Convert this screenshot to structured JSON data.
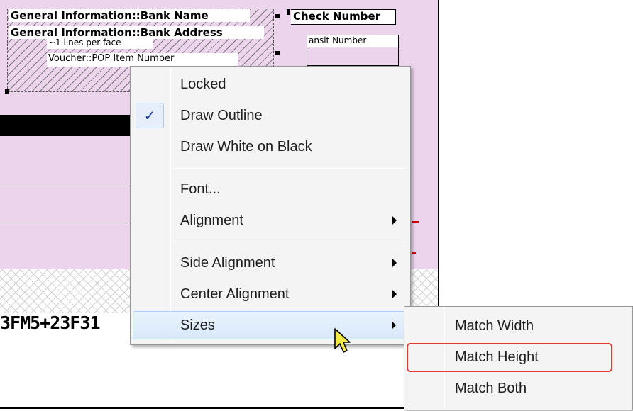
{
  "canvas": {
    "fields": {
      "bank_name": "General Information::Bank Name",
      "bank_address": "General Information::Bank Address",
      "lines_per_face": "~1 lines per face",
      "item_number": "Voucher::POP Item Number",
      "check_number": "Check Number",
      "transit_number": "ansit Number"
    },
    "barcode_text": "3FM5+23F31"
  },
  "context_menu": {
    "items": [
      {
        "label": "Locked",
        "checked": false,
        "has_submenu": false
      },
      {
        "label": "Draw Outline",
        "checked": true,
        "has_submenu": false
      },
      {
        "label": "Draw White on Black",
        "checked": false,
        "has_submenu": false
      },
      {
        "label": "Font...",
        "checked": false,
        "has_submenu": false
      },
      {
        "label": "Alignment",
        "checked": false,
        "has_submenu": true
      },
      {
        "label": "Side Alignment",
        "checked": false,
        "has_submenu": true
      },
      {
        "label": "Center Alignment",
        "checked": false,
        "has_submenu": true
      },
      {
        "label": "Sizes",
        "checked": false,
        "has_submenu": true,
        "hovered": true
      }
    ],
    "check_glyph": "✓"
  },
  "sizes_submenu": {
    "items": [
      {
        "label": "Match Width"
      },
      {
        "label": "Match Height",
        "highlighted": true
      },
      {
        "label": "Match Both"
      }
    ]
  },
  "colors": {
    "canvas_pink": "#ecd5ec",
    "menu_background": "#f4f4f4",
    "hover_fill": "#d8e8fb",
    "check_color": "#1b3fa0",
    "highlight_outline": "#e53935"
  }
}
